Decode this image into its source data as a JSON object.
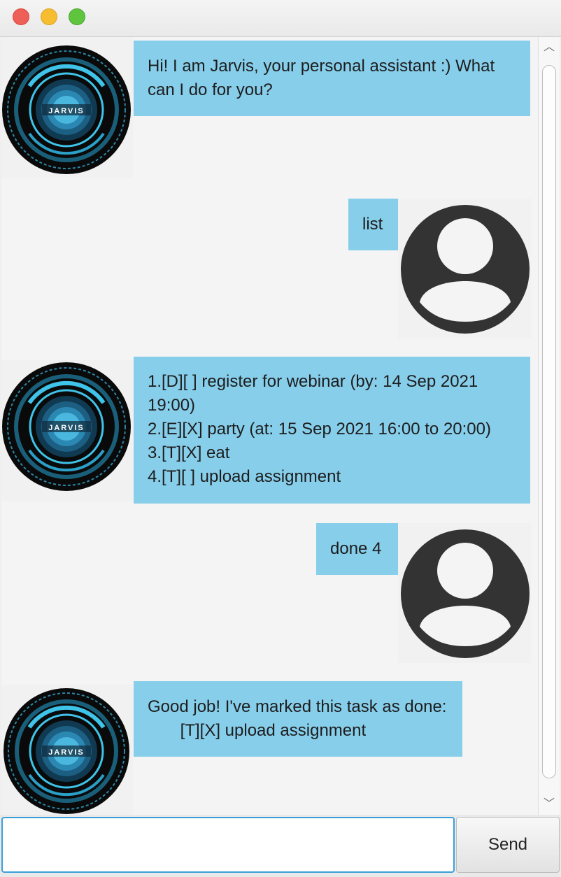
{
  "window": {
    "controls": [
      "close",
      "minimize",
      "maximize"
    ]
  },
  "conversation": [
    {
      "sender": "bot",
      "avatar_icon": "jarvis-avatar-icon",
      "avatar_label": "JARVIS",
      "lines": [
        "Hi! I am Jarvis, your personal assistant :) What",
        "can I do for you?"
      ]
    },
    {
      "sender": "user",
      "avatar_icon": "user-avatar-icon",
      "lines": [
        "list"
      ]
    },
    {
      "sender": "bot",
      "avatar_icon": "jarvis-avatar-icon",
      "avatar_label": "JARVIS",
      "lines": [
        "1.[D][ ] register for webinar (by: 14 Sep 2021",
        "19:00)",
        "2.[E][X] party (at: 15 Sep 2021 16:00 to 20:00)",
        "3.[T][X] eat",
        "4.[T][ ] upload assignment"
      ]
    },
    {
      "sender": "user",
      "avatar_icon": "user-avatar-icon",
      "lines": [
        "done 4"
      ]
    },
    {
      "sender": "bot",
      "avatar_icon": "jarvis-avatar-icon",
      "avatar_label": "JARVIS",
      "lines": [
        "Good job! I've marked this task as done:",
        "       [T][X] upload assignment"
      ]
    }
  ],
  "input": {
    "value": "",
    "placeholder": ""
  },
  "send_button": {
    "label": "Send"
  },
  "colors": {
    "bubble": "#87ceeb",
    "user_avatar": "#333333",
    "jarvis_accent": "#3fc3e8",
    "input_focus": "#3aa0d8"
  }
}
